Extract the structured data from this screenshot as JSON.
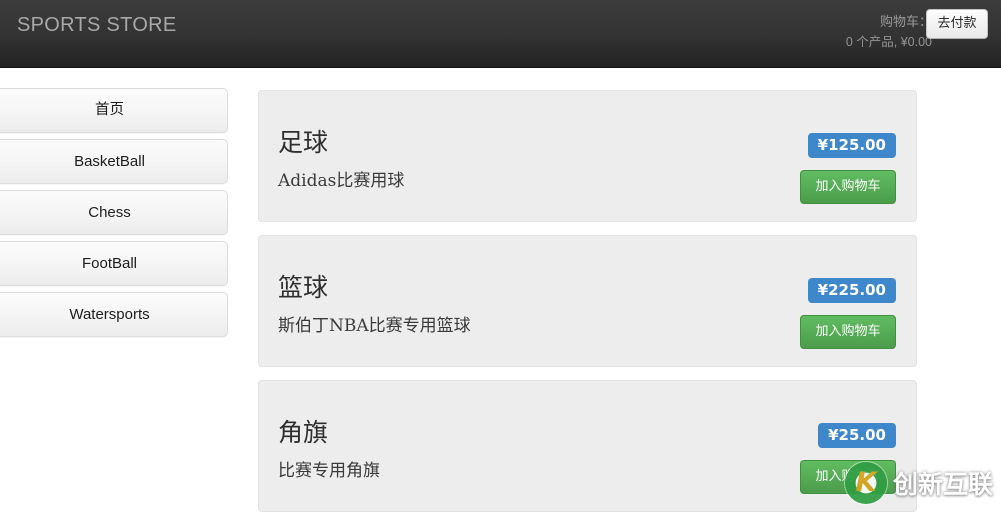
{
  "header": {
    "brand": "SPORTS STORE",
    "cart_label": "购物车：",
    "cart_status": "0 个产品, ¥0.00",
    "checkout_label": "去付款"
  },
  "sidebar": {
    "items": [
      {
        "label": "首页",
        "cjk": true
      },
      {
        "label": "BasketBall",
        "cjk": false
      },
      {
        "label": "Chess",
        "cjk": false
      },
      {
        "label": "FootBall",
        "cjk": false
      },
      {
        "label": "Watersports",
        "cjk": false
      }
    ]
  },
  "products": [
    {
      "name": "足球",
      "description": "Adidas比赛用球",
      "price": "¥125.00",
      "add_label": "加入购物车"
    },
    {
      "name": "篮球",
      "description": "斯伯丁NBA比赛专用篮球",
      "price": "¥225.00",
      "add_label": "加入购物车"
    },
    {
      "name": "角旗",
      "description": "比赛专用角旗",
      "price": "¥25.00",
      "add_label": "加入购物车"
    }
  ],
  "watermark": {
    "text": "创新互联",
    "logo_glyph": "K"
  },
  "colors": {
    "header_bg": "#333333",
    "price_badge": "#3d87ca",
    "add_button": "#55ab55",
    "card_bg": "#ededed",
    "watermark_green": "#2f9e44"
  }
}
